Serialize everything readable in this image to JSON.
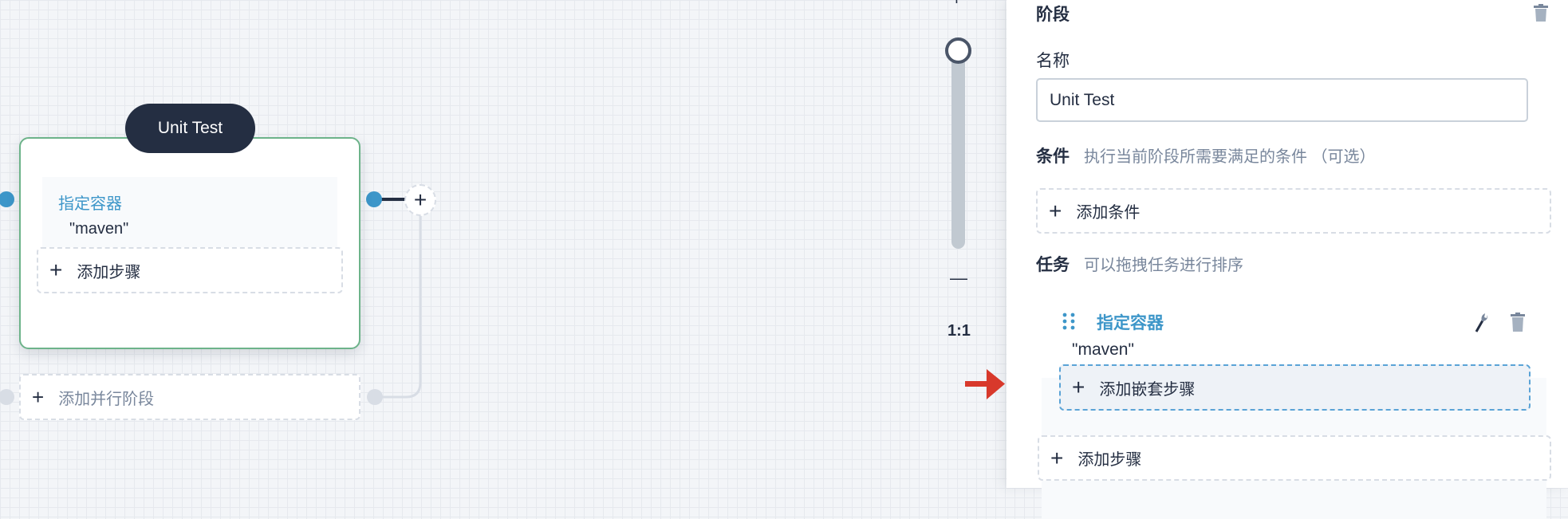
{
  "canvas": {
    "stage": {
      "name": "Unit Test",
      "step_title": "指定容器",
      "step_value": "\"maven\"",
      "add_step": "添加步骤"
    },
    "add_parallel": "添加并行阶段"
  },
  "zoom": {
    "plus": "+",
    "minus": "—",
    "reset": "1:1",
    "level": 1.0
  },
  "panel": {
    "title": "阶段",
    "name_label": "名称",
    "name_value": "Unit Test",
    "condition_label": "条件",
    "condition_hint": "执行当前阶段所需要满足的条件 （可选）",
    "add_condition": "添加条件",
    "task_label": "任务",
    "task_hint": "可以拖拽任务进行排序",
    "task": {
      "title": "指定容器",
      "value": "\"maven\"",
      "add_nested": "添加嵌套步骤"
    },
    "add_step": "添加步骤"
  },
  "colors": {
    "accent": "#3d96c9",
    "stage_border": "#6db38a",
    "dark": "#242e42",
    "arrow": "#d8392b"
  }
}
